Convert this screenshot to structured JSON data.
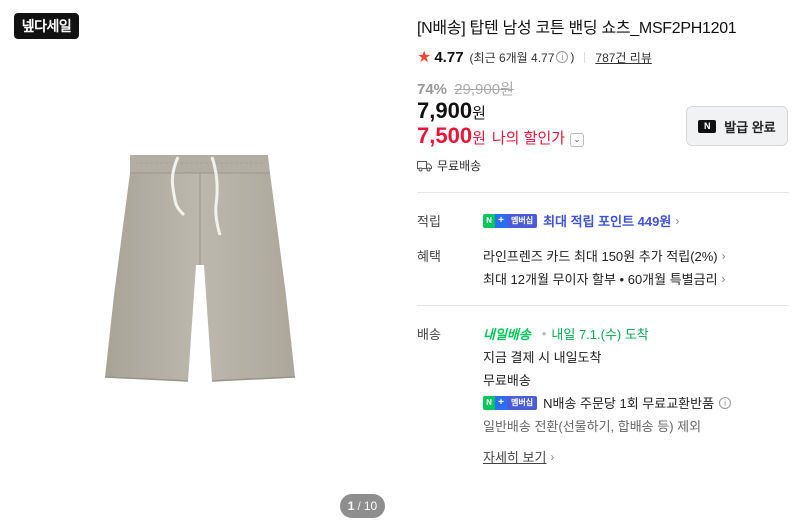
{
  "brand_badge": "넾다세일",
  "pager": {
    "current": "1",
    "separator": "/",
    "total": "10"
  },
  "product": {
    "title": "[N배송] 탑텐 남성 코튼 밴딩 쇼츠_MSF2PH1201"
  },
  "rating": {
    "score": "4.77",
    "recent": "(최근 6개월 4.77",
    "recent_close": ")",
    "reviews": "787건 리뷰"
  },
  "price": {
    "discount": "74%",
    "original": "29,900원",
    "sale": "7,900",
    "sale_unit": "원",
    "my_price": "7,500",
    "my_unit": "원",
    "my_label": "나의 할인가"
  },
  "coupon": {
    "label": "발급 완료",
    "icon_text": "N"
  },
  "shipping": {
    "free": "무료배송"
  },
  "benefits": {
    "points_label": "적립",
    "points_value": "최대 적립 포인트 449원",
    "benefit_label": "혜택",
    "benefit_1": "라인프렌즈 카드 최대 150원 추가 적립(2%)",
    "benefit_2": "최대 12개월 무이자 할부 • 60개월 특별금리"
  },
  "delivery": {
    "label": "배송",
    "logo": "내일배송",
    "arrival": "내일 7.1.(수) 도착",
    "line_1": "지금 결제 시 내일도착",
    "line_2": "무료배송",
    "line_3": "N배송 주문당 1회 무료교환반품",
    "line_4": "일반배송 전환(선물하기, 합배송 등) 제외",
    "more": "자세히 보기"
  },
  "membership_badge": {
    "n": "N",
    "plus": "+",
    "mem": "멤버십"
  },
  "colors": {
    "accent_red": "#e8143a",
    "naver_green": "#03c75a",
    "points_blue": "#3f51d5",
    "star": "#f04a2e"
  }
}
